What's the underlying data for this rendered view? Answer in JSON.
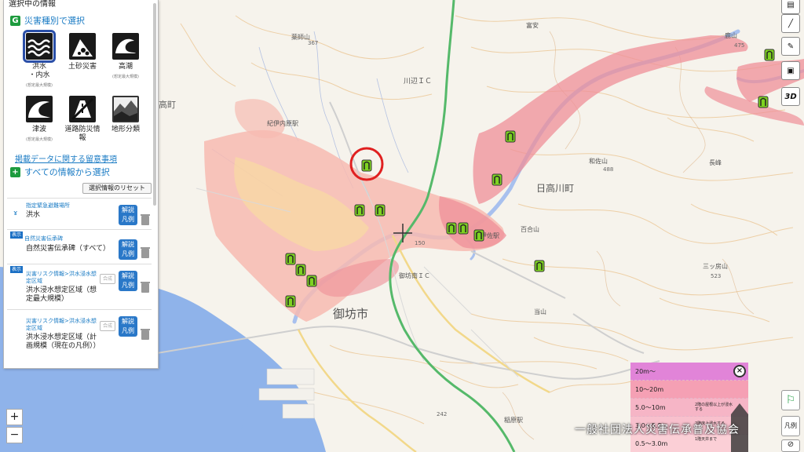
{
  "panel": {
    "title": "選択中の情報",
    "disaster_section": "災害種別で選択",
    "hazards": [
      {
        "label": "洪水",
        "label2": "・内水",
        "sub": "(想定最大規模)",
        "icon": "flood-waves-icon",
        "selected": true
      },
      {
        "label": "土砂災害",
        "label2": "",
        "sub": "",
        "icon": "landslide-icon",
        "selected": false
      },
      {
        "label": "高潮",
        "label2": "",
        "sub": "(想定最大規模)",
        "icon": "storm-surge-icon",
        "selected": false
      },
      {
        "label": "津波",
        "label2": "",
        "sub": "(想定最大規模)",
        "icon": "tsunami-icon",
        "selected": false
      },
      {
        "label": "道路防災情報",
        "label2": "",
        "sub": "",
        "icon": "road-disaster-icon",
        "selected": false
      },
      {
        "label": "地形分類",
        "label2": "",
        "sub": "",
        "icon": "terrain-icon",
        "selected": false
      }
    ],
    "notice_link": "掲載データに関する留意事項",
    "all_info_section": "すべての情報から選択",
    "reset_button": "選択情報のリセット",
    "layers": [
      {
        "category": "指定緊急避難場所",
        "name": "洪水",
        "show": "",
        "composite": false
      },
      {
        "category": "自然災害伝承碑",
        "name": "自然災害伝承碑（すべて）",
        "show": "表示",
        "composite": false
      },
      {
        "category": "災害リスク情報>洪水浸水想定区域",
        "name": "洪水浸水想定区域（想定最大規模）",
        "show": "表示",
        "composite": true
      },
      {
        "category": "災害リスク情報>洪水浸水想定区域",
        "name": "洪水浸水想定区域（計画規模（現在の凡例））",
        "show": "",
        "composite": true
      }
    ],
    "legend_label": "解説\n凡例",
    "composite_label": "合成"
  },
  "map_labels": {
    "gobo_city": "御坊市",
    "hidakagawa_town": "日高川町",
    "takacho": "高町",
    "kawabe_ic": "川辺ＩＣ",
    "gobo_minami_ic": "御坊南ＩＣ",
    "kiisa_station": "紀伊佐駅",
    "inahara_station": "稲原駅",
    "wasa_mountain": "和佐山",
    "mitsubusa": "三ッ房山",
    "yakushi_mountain": "薬師山",
    "tomiyasu": "富安",
    "kinosaki": "紀伊内原駅",
    "toudaiji": "当山",
    "ichinohe": "百合山",
    "kanasan": "鹿山",
    "nagane": "長峰"
  },
  "map_numbers": {
    "wasa": "488",
    "kakiyama": "475",
    "nishi": "367",
    "mitsu": "523",
    "tsukayama": "242",
    "tm": "150"
  },
  "depth_legend": {
    "rows": [
      {
        "label": "20m～",
        "color": "#e184d8"
      },
      {
        "label": "10～20m",
        "color": "#f5a0b4"
      },
      {
        "label": "5.0～10m",
        "color": "#f6b5c6"
      },
      {
        "label": "3.0～5.0m",
        "color": "#f8c0cd"
      },
      {
        "label": "0.5～3.0m",
        "color": "#fbcfd6"
      }
    ],
    "note1": "2階の屋根以上が浸水する",
    "note2": "2階床上浸水する",
    "note3": "1階天井まで"
  },
  "watermark": "一般社団法人災害伝承普及協会",
  "controls": {
    "zoom_in": "+",
    "zoom_out": "−",
    "three_d": "3D",
    "legend_side": "凡例"
  },
  "colors": {
    "flood_zone": "#f7b9b1",
    "flood_deep": "#ef8f98",
    "flood_light": "#f9e29a",
    "river": "#9fb7e8",
    "sea": "#8fb3ea",
    "expressway": "#55b96a",
    "highlight_circle": "#e02020",
    "shelter_marker": "#7ed321"
  }
}
